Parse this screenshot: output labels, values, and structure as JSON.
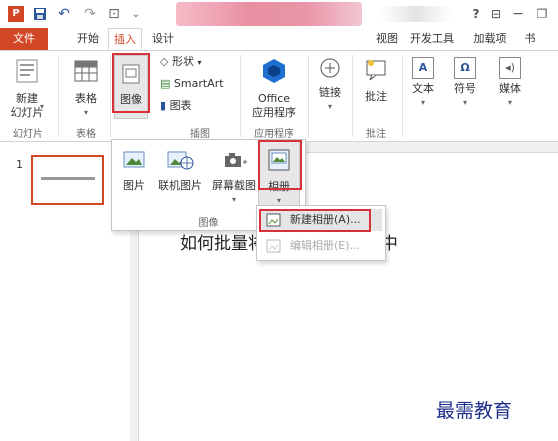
{
  "app": {
    "name": "PowerPoint"
  },
  "titlebar": {
    "help_icon": "?"
  },
  "tabs": [
    "文件",
    "开始",
    "插入",
    "设计",
    "视图",
    "开发工具",
    "加载项",
    "书"
  ],
  "ribbon": {
    "new_slide": "新建\n幻灯片",
    "table": "表格",
    "image": "图像",
    "shapes": "形状",
    "smartart": "SmartArt",
    "chart": "图表",
    "office_apps": "Office\n应用程序",
    "link": "链接",
    "comment": "批注",
    "text": "文本",
    "symbol": "符号",
    "media": "媒体",
    "groups": {
      "slides": "幻灯片",
      "tables": "表格",
      "illustrations": "插图",
      "apps": "应用程序",
      "comments": "批注"
    }
  },
  "dropdown": {
    "picture": "图片",
    "online_picture": "联机图片",
    "screenshot": "屏幕截图",
    "album": "相册",
    "group_label": "图像"
  },
  "submenu": {
    "new_album": "新建相册(A)...",
    "edit_album": "编辑相册(E)..."
  },
  "slide": {
    "number": "1",
    "title": "如何批量将图片导入到PPT中"
  },
  "watermark": "最需教育",
  "colors": {
    "accent": "#D24726",
    "highlight": "#D9303A"
  }
}
